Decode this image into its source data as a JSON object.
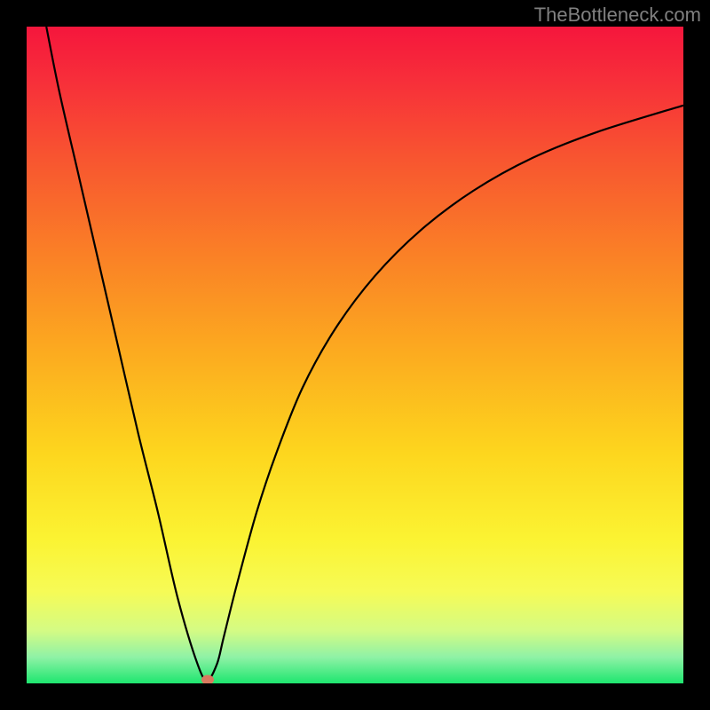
{
  "watermark": "TheBottleneck.com",
  "chart_data": {
    "type": "line",
    "title": "",
    "xlabel": "",
    "ylabel": "",
    "xlim": [
      0,
      100
    ],
    "ylim": [
      0,
      100
    ],
    "background_gradient": {
      "stops": [
        {
          "offset": 0.0,
          "color": "#f5163c"
        },
        {
          "offset": 0.08,
          "color": "#f72e3a"
        },
        {
          "offset": 0.2,
          "color": "#f85530"
        },
        {
          "offset": 0.35,
          "color": "#fa8126"
        },
        {
          "offset": 0.5,
          "color": "#fcac1f"
        },
        {
          "offset": 0.65,
          "color": "#fdd61e"
        },
        {
          "offset": 0.78,
          "color": "#fbf332"
        },
        {
          "offset": 0.86,
          "color": "#f6fb56"
        },
        {
          "offset": 0.92,
          "color": "#d4fb84"
        },
        {
          "offset": 0.96,
          "color": "#8ff2a6"
        },
        {
          "offset": 1.0,
          "color": "#1ee66f"
        }
      ]
    },
    "series": [
      {
        "name": "curve",
        "color": "#000000",
        "x": [
          3,
          5,
          8,
          11,
          14,
          17,
          20,
          23,
          26,
          27.5,
          29,
          30,
          32,
          35,
          38,
          42,
          47,
          53,
          60,
          68,
          77,
          87,
          100
        ],
        "y": [
          100,
          90,
          77,
          64,
          51,
          38,
          26,
          13,
          3,
          0.5,
          3,
          7,
          15,
          26,
          35,
          45,
          54,
          62,
          69,
          75,
          80,
          84,
          88
        ]
      }
    ],
    "marker": {
      "x": 27.5,
      "y": 0.5,
      "color": "#d97a5f"
    }
  }
}
